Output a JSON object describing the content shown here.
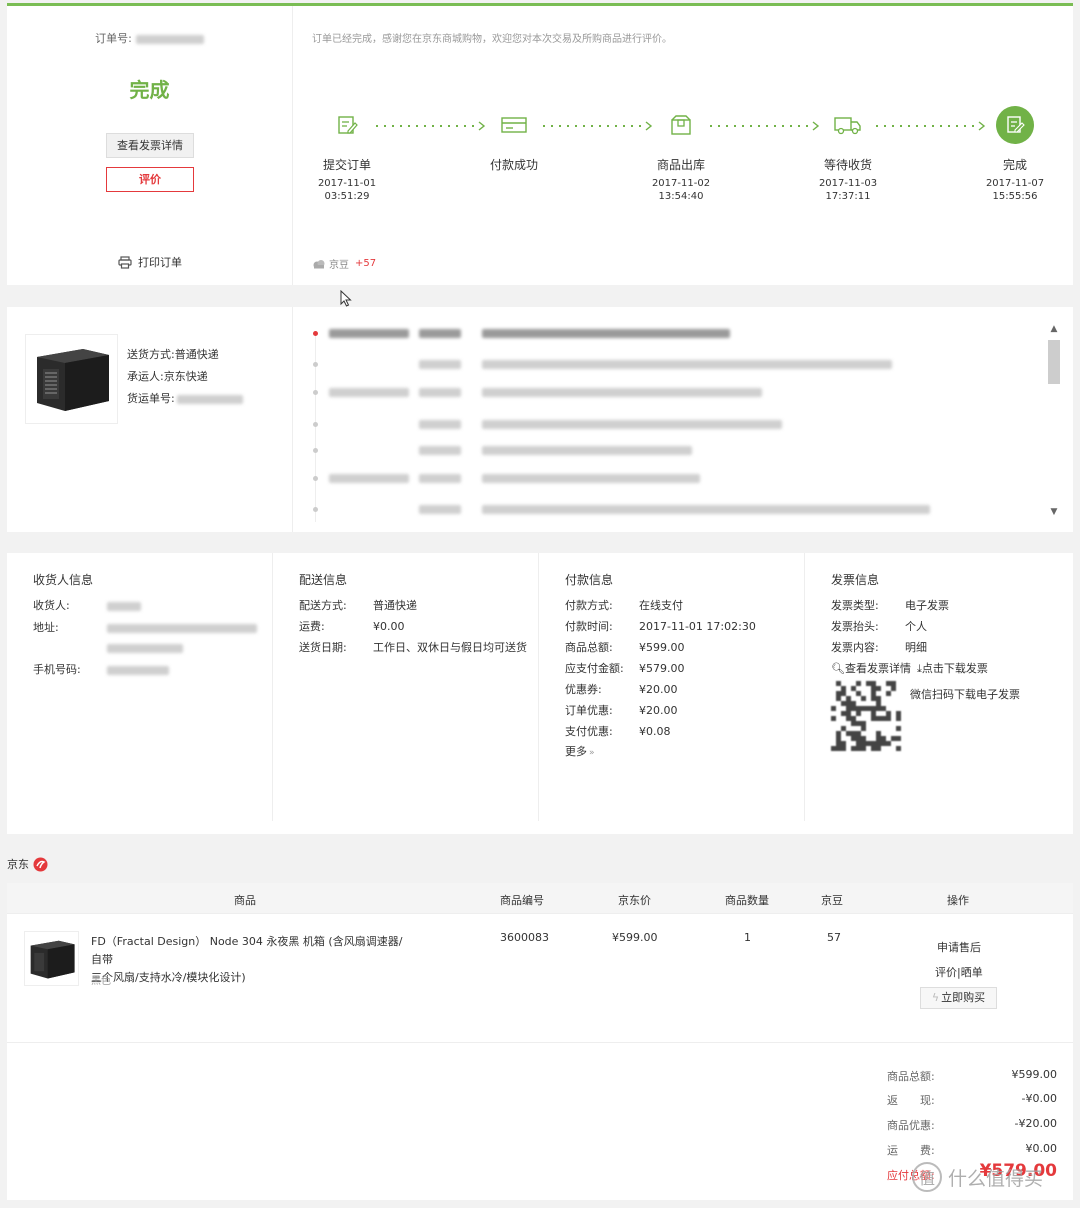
{
  "status": {
    "order_no_label": "订单号:",
    "status_text": "完成",
    "invoice_button": "查看发票详情",
    "review_button": "评价",
    "print_label": "打印订单",
    "message": "订单已经完成，感谢您在京东商城购物，欢迎您对本次交易及所购商品进行评价。",
    "steps": [
      {
        "name": "提交订单",
        "date": "2017-11-01",
        "time": "03:51:29"
      },
      {
        "name": "付款成功",
        "date": "",
        "time": ""
      },
      {
        "name": "商品出库",
        "date": "2017-11-02",
        "time": "13:54:40"
      },
      {
        "name": "等待收货",
        "date": "2017-11-03",
        "time": "17:37:11"
      },
      {
        "name": "完成",
        "date": "2017-11-07",
        "time": "15:55:56"
      }
    ],
    "jingdou_label": "京豆",
    "jingdou_value": "+57"
  },
  "shipping": {
    "method_label": "送货方式:",
    "method_value": "普通快递",
    "carrier_label": "承运人:",
    "carrier_value": "京东快递",
    "tracking_label": "货运单号:"
  },
  "info": {
    "receiver": {
      "title": "收货人信息",
      "name_label": "收货人:",
      "address_label": "地址:",
      "phone_label": "手机号码:"
    },
    "delivery": {
      "title": "配送信息",
      "method_label": "配送方式:",
      "method_value": "普通快递",
      "fee_label": "运费:",
      "fee_value": "¥0.00",
      "date_label": "送货日期:",
      "date_value": "工作日、双休日与假日均可送货"
    },
    "payment": {
      "title": "付款信息",
      "rows": [
        {
          "k": "付款方式:",
          "v": "在线支付"
        },
        {
          "k": "付款时间:",
          "v": "2017-11-01 17:02:30"
        },
        {
          "k": "商品总额:",
          "v": "¥599.00"
        },
        {
          "k": "应支付金额:",
          "v": "¥579.00"
        },
        {
          "k": "优惠券:",
          "v": "¥20.00"
        },
        {
          "k": "订单优惠:",
          "v": "¥20.00"
        },
        {
          "k": "支付优惠:",
          "v": "¥0.08"
        }
      ],
      "more": "更多"
    },
    "invoice": {
      "title": "发票信息",
      "type_label": "发票类型:",
      "type_value": "电子发票",
      "header_label": "发票抬头:",
      "header_value": "个人",
      "content_label": "发票内容:",
      "content_value": "明细",
      "view_link": "查看发票详情",
      "download_link": "点击下载发票",
      "wechat_text": "微信扫码下载电子发票"
    }
  },
  "order": {
    "shop_name": "京东",
    "headers": [
      "商品",
      "商品编号",
      "京东价",
      "商品数量",
      "京豆",
      "操作"
    ],
    "product": {
      "name_line1": "FD（Fractal Design） Node 304 永夜黑 机箱 (含风扇调速器/自带",
      "name_line2": "三个风扇/支持水冷/模块化设计)",
      "color": "黑色",
      "sku": "3600083",
      "price": "¥599.00",
      "quantity": "1",
      "jingdou": "57"
    },
    "actions": {
      "after_sale": "申请售后",
      "review": "评价|晒单",
      "buy_again": "立即购买"
    },
    "summary": [
      {
        "k": "商品总额:",
        "v": "¥599.00"
      },
      {
        "k": "返　　现:",
        "v": "-¥0.00"
      },
      {
        "k": "商品优惠:",
        "v": "-¥20.00"
      },
      {
        "k": "运　　费:",
        "v": "¥0.00"
      }
    ],
    "payable_label": "应付总额:",
    "payable_value": "¥579.00"
  },
  "watermark": "什么值得买",
  "colors": {
    "accent_green": "#71b247",
    "accent_red": "#e4393c"
  }
}
